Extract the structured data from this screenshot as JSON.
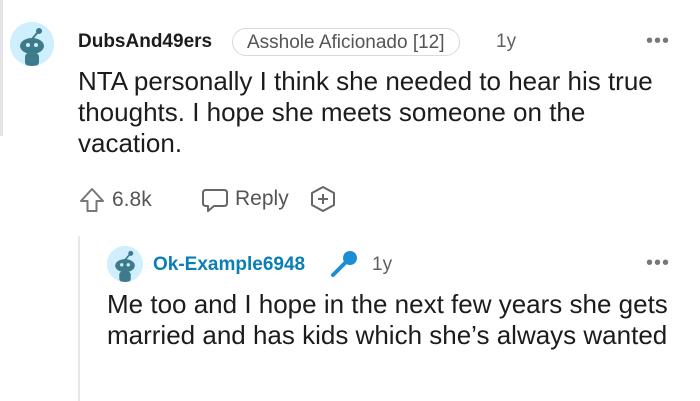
{
  "comment": {
    "username": "DubsAnd49ers",
    "flair": "Asshole Aficionado [12]",
    "age": "1y",
    "more": "•••",
    "body": "NTA personally I think she needed to hear his true thoughts. I hope she meets someone on the vacation.",
    "upvotes": "6.8k",
    "reply_label": "Reply",
    "icons": {
      "upvote": "upvote-arrow-icon",
      "reply": "speech-bubble-icon",
      "award": "plus-award-icon"
    }
  },
  "reply": {
    "username": "Ok-Example6948",
    "age": "1y",
    "more": "•••",
    "body": "Me too and I hope in the next few years she gets married and has kids which she’s always wanted",
    "badge_icon": "microphone-icon"
  },
  "colors": {
    "reply_username": "#0a7fb5",
    "avatar_bg": "#cfeefe",
    "mic": "#1a8fd6"
  }
}
